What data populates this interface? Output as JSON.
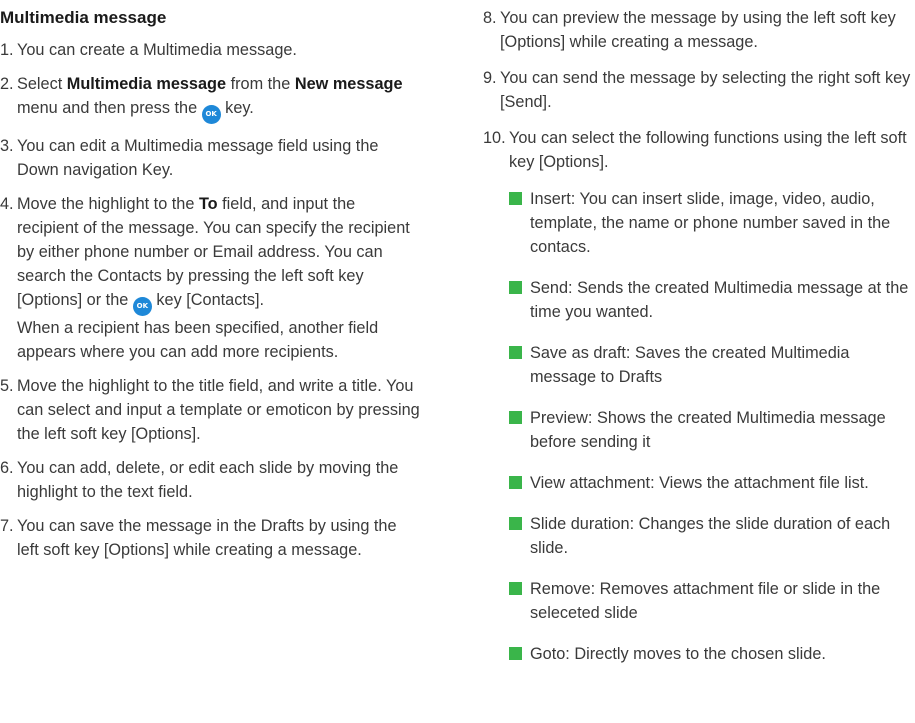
{
  "title": "Multimedia message",
  "icons": {
    "ok_key": "ok-key-icon",
    "ok_text": "OK",
    "bullet": "green-square-bullet",
    "ok_color": "#1e88d8",
    "bullet_color": "#3ab54a"
  },
  "steps": {
    "s1": {
      "num": "1.",
      "text": "You can create a Multimedia message."
    },
    "s2": {
      "num": "2.",
      "a": "Select ",
      "b1": "Multimedia message",
      "c": " from the ",
      "b2": "New message",
      "d": " menu and then press the ",
      "e": " key."
    },
    "s3": {
      "num": "3.",
      "text": "You can edit a Multimedia message field using the Down navigation Key."
    },
    "s4": {
      "num": "4.",
      "a": "Move the highlight to the ",
      "b1": "To",
      "c": " field, and input the recipient of the message. You can specify the recipient by either phone number or Email address. You can search the Contacts by pressing the left soft key [Options] or the ",
      "d": " key [Contacts].",
      "e": "When a recipient has been specified, another field appears where you can add more recipients."
    },
    "s5": {
      "num": "5.",
      "text": "Move the highlight to the title field, and write a title. You can select and input a template or emoticon by pressing the left soft key [Options]."
    },
    "s6": {
      "num": "6.",
      "text": "You can add, delete, or edit each slide by moving the highlight to the text field."
    },
    "s7": {
      "num": "7.",
      "text": "You can save the message in the Drafts by using the left soft key [Options] while creating a message."
    },
    "s8": {
      "num": "8.",
      "text": "You can preview the message by using the left soft key [Options] while creating a message."
    },
    "s9": {
      "num": "9.",
      "text": "You can send the message by selecting the right soft key [Send]."
    },
    "s10": {
      "num": "10.",
      "text": "You can select the following functions using the left soft key [Options]."
    }
  },
  "functions": [
    "Insert: You can insert slide, image, video, audio, template, the name or phone number saved in the contacs.",
    "Send: Sends the created Multimedia message at the time you wanted.",
    "Save as draft: Saves the created Multimedia message to Drafts",
    "Preview: Shows the created Multimedia message before sending it",
    "View attachment: Views the attachment file list.",
    "Slide duration: Changes the slide duration of each slide.",
    "Remove: Removes attachment file or slide in the seleceted slide",
    "Goto: Directly moves to the chosen slide."
  ]
}
